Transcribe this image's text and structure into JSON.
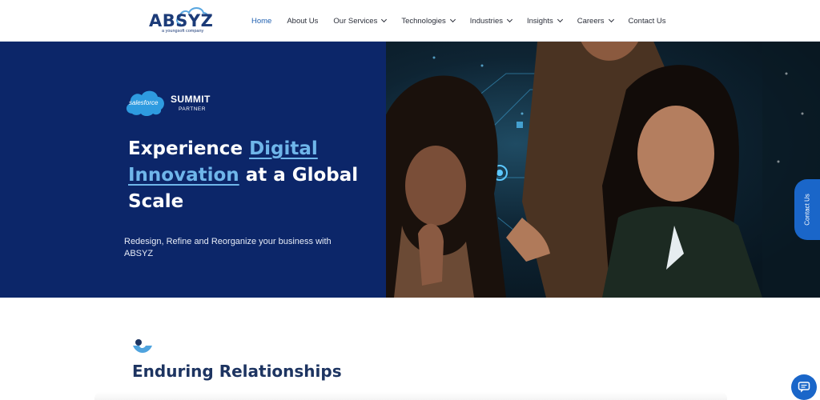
{
  "header": {
    "logo_text": "ABSYZ",
    "logo_subtext": "a youngsoft company",
    "nav": [
      {
        "label": "Home",
        "active": true,
        "dropdown": false
      },
      {
        "label": "About Us",
        "active": false,
        "dropdown": false
      },
      {
        "label": "Our Services",
        "active": false,
        "dropdown": true
      },
      {
        "label": "Technologies",
        "active": false,
        "dropdown": true
      },
      {
        "label": "Industries",
        "active": false,
        "dropdown": true
      },
      {
        "label": "Insights",
        "active": false,
        "dropdown": true
      },
      {
        "label": "Careers",
        "active": false,
        "dropdown": true
      },
      {
        "label": "Contact Us",
        "active": false,
        "dropdown": false
      }
    ]
  },
  "hero": {
    "badge_logo": "salesforce",
    "badge_title": "SUMMIT",
    "badge_subtitle": "PARTNER",
    "title_part1": "Experience ",
    "title_highlight1": "Digital",
    "title_highlight2": "Innovation",
    "title_part2": " at a Global Scale",
    "subtitle": "Redesign, Refine and Reorganize your business with ABSYZ"
  },
  "contact_tab": {
    "label": "Contact Us"
  },
  "section": {
    "title": "Enduring Relationships"
  },
  "icons": {
    "chat": "chat-icon",
    "section": "relationship-icon",
    "cloud": "cloud-icon"
  },
  "colors": {
    "hero_bg": "#0c2669",
    "accent": "#1a66c9",
    "highlight": "#6fb6ea",
    "active_nav": "#1f5fb0"
  }
}
